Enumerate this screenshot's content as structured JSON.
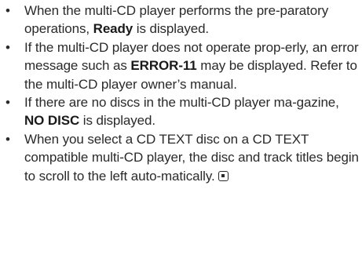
{
  "notes": [
    {
      "pre": "When the multi-CD player performs the pre-paratory operations, ",
      "bold": "Ready",
      "post": " is displayed."
    },
    {
      "pre": "If the multi-CD player does not operate prop-erly, an error message such as ",
      "bold": "ERROR-11",
      "post": " may be displayed. Refer to the multi-CD player owner’s manual."
    },
    {
      "pre": "If there are no discs in the multi-CD player ma-gazine, ",
      "bold": "NO DISC",
      "post": " is displayed."
    },
    {
      "text": "When you select a CD TEXT disc on a CD TEXT compatible multi-CD player, the disc and track titles begin to scroll to the left auto-matically."
    }
  ],
  "bullet_symbol": "•",
  "end_mark_icon": "end-of-section-icon"
}
